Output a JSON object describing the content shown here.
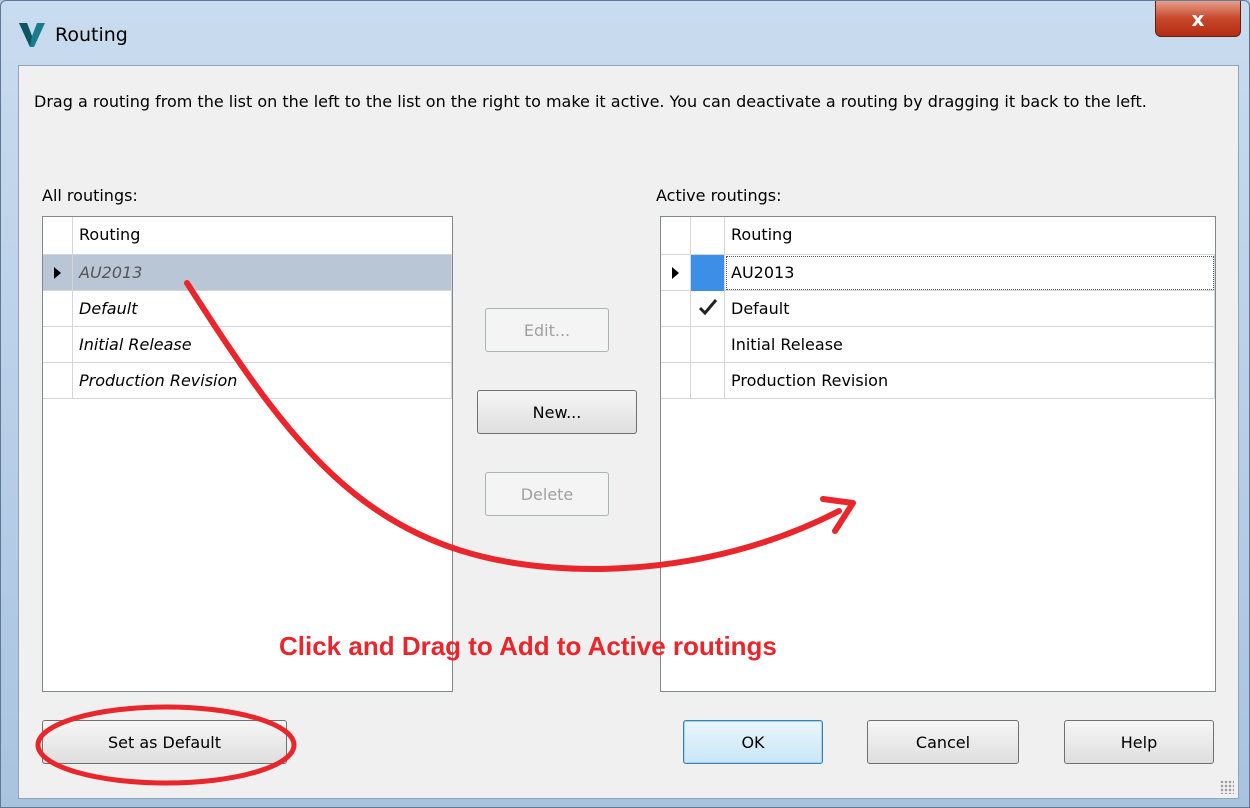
{
  "window": {
    "title": "Routing",
    "close_glyph": "x"
  },
  "instructions": "Drag a routing from the list on the left to the list on the right to make it active. You can deactivate a routing by dragging it back to the left.",
  "all_routings": {
    "label": "All routings:",
    "column_header": "Routing",
    "rows": [
      "AU2013",
      "Default",
      "Initial Release",
      "Production Revision"
    ],
    "selected_index": 0
  },
  "active_routings": {
    "label": "Active routings:",
    "column_header": "Routing",
    "rows": [
      "AU2013",
      "Default",
      "Initial Release",
      "Production Revision"
    ],
    "selected_index": 0,
    "default_index": 1
  },
  "buttons": {
    "edit": "Edit...",
    "new": "New...",
    "delete": "Delete",
    "set_default": "Set as Default",
    "ok": "OK",
    "cancel": "Cancel",
    "help": "Help"
  },
  "annotation": {
    "text": "Click and Drag to Add to Active routings",
    "color": "#e8262c"
  },
  "colors": {
    "selection": "#b8c6d6",
    "active_marker": "#3d8ee6"
  },
  "icons": {
    "app": "vault-logo-icon",
    "check": "check-icon",
    "row_pointer": "row-pointer-icon"
  }
}
